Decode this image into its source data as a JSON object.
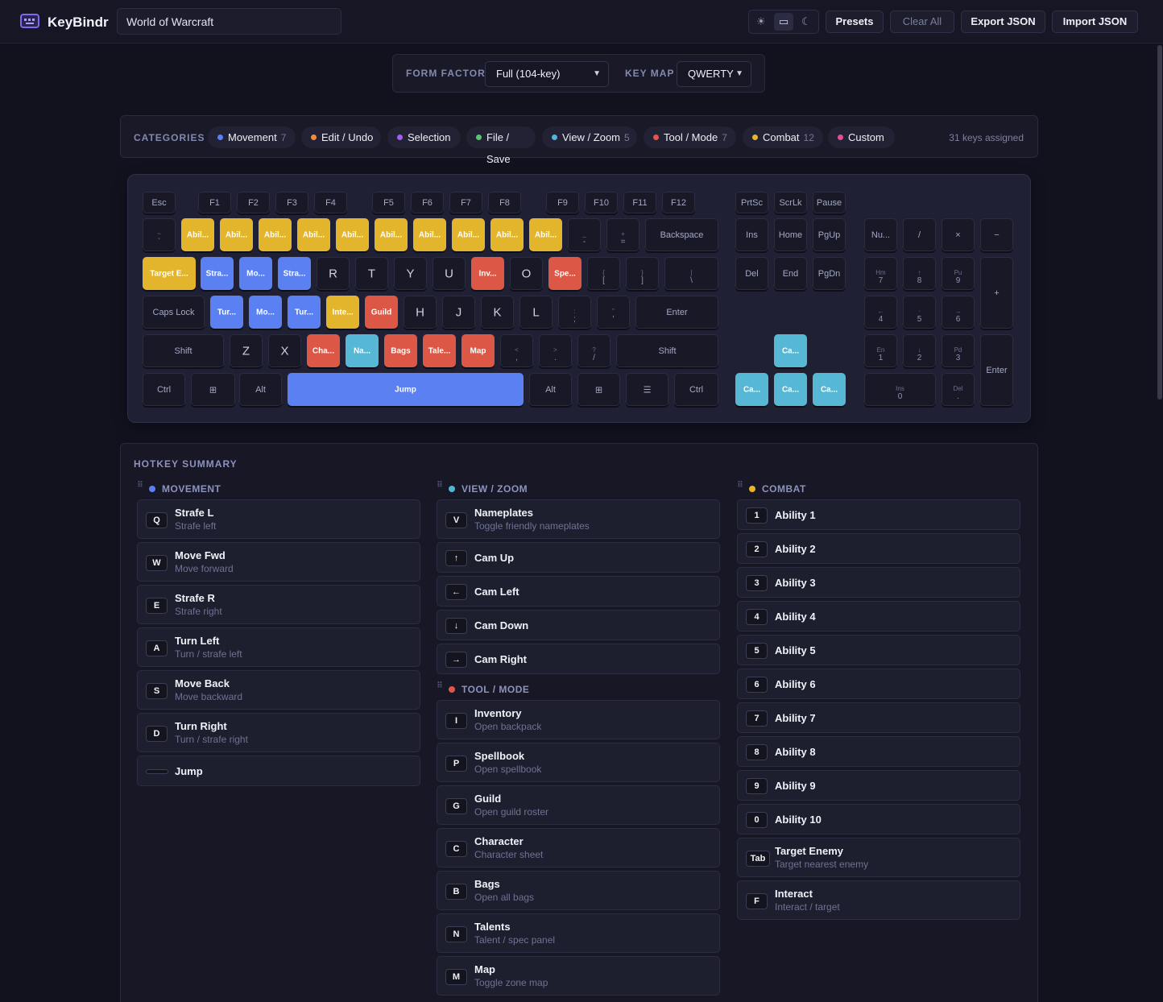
{
  "app": {
    "name": "KeyBindr",
    "preset_name": "World of Warcraft"
  },
  "toolbar": {
    "theme_light": "☀",
    "theme_system": "▭",
    "theme_dark": "☾",
    "presets": "Presets",
    "clear_all": "Clear All",
    "export_json": "Export JSON",
    "import_json": "Import JSON"
  },
  "form": {
    "form_factor_label": "FORM FACTOR",
    "form_factor_value": "Full (104-key)",
    "keymap_label": "KEY MAP",
    "keymap_value": "QWERTY"
  },
  "categories_label": "CATEGORIES",
  "categories": [
    {
      "name": "Movement",
      "count": "7",
      "color": "#5b7ff5"
    },
    {
      "name": "Edit / Undo",
      "count": "",
      "color": "#f08a3c"
    },
    {
      "name": "Selection",
      "count": "",
      "color": "#a55cf0"
    },
    {
      "name": "File / Save",
      "count": "",
      "color": "#55c76a"
    },
    {
      "name": "View / Zoom",
      "count": "5",
      "color": "#4fb6d6"
    },
    {
      "name": "Tool / Mode",
      "count": "7",
      "color": "#e0584a"
    },
    {
      "name": "Combat",
      "count": "12",
      "color": "#e6b52c"
    },
    {
      "name": "Custom",
      "count": "",
      "color": "#e4508f"
    }
  ],
  "assigned_text": "31 keys assigned",
  "keys": [
    {
      "t": "Esc"
    },
    {
      "t": "F1"
    },
    {
      "t": "F2"
    },
    {
      "t": "F3"
    },
    {
      "t": "F4"
    },
    {
      "t": "F5"
    },
    {
      "t": "F6"
    },
    {
      "t": "F7"
    },
    {
      "t": "F8"
    },
    {
      "t": "F9"
    },
    {
      "t": "F10"
    },
    {
      "t": "F11"
    },
    {
      "t": "F12"
    },
    {
      "t": "PrtSc"
    },
    {
      "t": "ScrLk"
    },
    {
      "t": "Pause"
    },
    {
      "t": "~",
      "s": "`"
    },
    {
      "t": "Abil...",
      "c": "combat"
    },
    {
      "t": "Abil...",
      "c": "combat"
    },
    {
      "t": "Abil...",
      "c": "combat"
    },
    {
      "t": "Abil...",
      "c": "combat"
    },
    {
      "t": "Abil...",
      "c": "combat"
    },
    {
      "t": "Abil...",
      "c": "combat"
    },
    {
      "t": "Abil...",
      "c": "combat"
    },
    {
      "t": "Abil...",
      "c": "combat"
    },
    {
      "t": "Abil...",
      "c": "combat"
    },
    {
      "t": "Abil...",
      "c": "combat"
    },
    {
      "t": "_",
      "s": "-"
    },
    {
      "t": "+",
      "s": "="
    },
    {
      "t": "Backspace"
    },
    {
      "t": "Ins"
    },
    {
      "t": "Home"
    },
    {
      "t": "PgUp"
    },
    {
      "t": "Nu..."
    },
    {
      "t": "/"
    },
    {
      "t": "×"
    },
    {
      "t": "−"
    },
    {
      "t": "Target E...",
      "c": "combat"
    },
    {
      "t": "Stra...",
      "c": "movement"
    },
    {
      "t": "Mo...",
      "c": "movement"
    },
    {
      "t": "Stra...",
      "c": "movement"
    },
    {
      "t": "R",
      "b": 1
    },
    {
      "t": "T",
      "b": 1
    },
    {
      "t": "Y",
      "b": 1
    },
    {
      "t": "U",
      "b": 1
    },
    {
      "t": "Inv...",
      "c": "tool"
    },
    {
      "t": "O",
      "b": 1
    },
    {
      "t": "Spe...",
      "c": "tool"
    },
    {
      "t": "{",
      "s": "["
    },
    {
      "t": "}",
      "s": "]"
    },
    {
      "t": "|",
      "s": "\\"
    },
    {
      "t": "Del"
    },
    {
      "t": "End"
    },
    {
      "t": "PgDn"
    },
    {
      "t": "Hm",
      "s": "7"
    },
    {
      "t": "↑",
      "s": "8"
    },
    {
      "t": "Pu",
      "s": "9"
    },
    {
      "t": "+"
    },
    {
      "t": "Caps Lock"
    },
    {
      "t": "Tur...",
      "c": "movement"
    },
    {
      "t": "Mo...",
      "c": "movement"
    },
    {
      "t": "Tur...",
      "c": "movement"
    },
    {
      "t": "Inte...",
      "c": "combat"
    },
    {
      "t": "Guild",
      "c": "tool"
    },
    {
      "t": "H",
      "b": 1
    },
    {
      "t": "J",
      "b": 1
    },
    {
      "t": "K",
      "b": 1
    },
    {
      "t": "L",
      "b": 1
    },
    {
      "t": ":",
      "s": ";"
    },
    {
      "t": "\"",
      "s": "'"
    },
    {
      "t": "Enter"
    },
    {
      "t": "←",
      "s": "4"
    },
    {
      "t": "·",
      "s": "5"
    },
    {
      "t": "→",
      "s": "6"
    },
    {
      "t": "Shift"
    },
    {
      "t": "Z",
      "b": 1
    },
    {
      "t": "X",
      "b": 1
    },
    {
      "t": "Cha...",
      "c": "tool"
    },
    {
      "t": "Na...",
      "c": "view"
    },
    {
      "t": "Bags",
      "c": "tool"
    },
    {
      "t": "Tale...",
      "c": "tool"
    },
    {
      "t": "Map",
      "c": "tool"
    },
    {
      "t": "<",
      "s": ","
    },
    {
      "t": ">",
      "s": "."
    },
    {
      "t": "?",
      "s": "/"
    },
    {
      "t": "Shift"
    },
    {
      "t": "Ca...",
      "c": "view"
    },
    {
      "t": "En",
      "s": "1"
    },
    {
      "t": "↓",
      "s": "2"
    },
    {
      "t": "Pd",
      "s": "3"
    },
    {
      "t": "Enter"
    },
    {
      "t": "Ctrl"
    },
    {
      "t": "⊞"
    },
    {
      "t": "Alt"
    },
    {
      "t": "Jump",
      "c": "movement"
    },
    {
      "t": "Alt"
    },
    {
      "t": "⊞"
    },
    {
      "t": "☰"
    },
    {
      "t": "Ctrl"
    },
    {
      "t": "Ca...",
      "c": "view"
    },
    {
      "t": "Ca...",
      "c": "view"
    },
    {
      "t": "Ca...",
      "c": "view"
    },
    {
      "t": "Ins",
      "s": "0"
    },
    {
      "t": "Del",
      "s": "."
    }
  ],
  "key_colors": {
    "combat": "#e3b52c",
    "movement": "#5b80f2",
    "tool": "#dc5746",
    "view": "#56b8d4"
  },
  "summary": {
    "title": "HOTKEY SUMMARY",
    "groups": [
      {
        "title": "MOVEMENT",
        "color": "#5b7ff5",
        "items": [
          {
            "key": "Q",
            "name": "Strafe L",
            "desc": "Strafe left"
          },
          {
            "key": "W",
            "name": "Move Fwd",
            "desc": "Move forward"
          },
          {
            "key": "E",
            "name": "Strafe R",
            "desc": "Strafe right"
          },
          {
            "key": "A",
            "name": "Turn Left",
            "desc": "Turn / strafe left"
          },
          {
            "key": "S",
            "name": "Move Back",
            "desc": "Move backward"
          },
          {
            "key": "D",
            "name": "Turn Right",
            "desc": "Turn / strafe right"
          },
          {
            "key": "",
            "name": "Jump",
            "desc": ""
          }
        ]
      },
      {
        "title": "VIEW / ZOOM",
        "color": "#4fb6d6",
        "items": [
          {
            "key": "V",
            "name": "Nameplates",
            "desc": "Toggle friendly nameplates"
          },
          {
            "key": "↑",
            "name": "Cam Up",
            "desc": ""
          },
          {
            "key": "←",
            "name": "Cam Left",
            "desc": ""
          },
          {
            "key": "↓",
            "name": "Cam Down",
            "desc": ""
          },
          {
            "key": "→",
            "name": "Cam Right",
            "desc": ""
          }
        ]
      },
      {
        "title": "TOOL / MODE",
        "color": "#e0584a",
        "items": [
          {
            "key": "I",
            "name": "Inventory",
            "desc": "Open backpack"
          },
          {
            "key": "P",
            "name": "Spellbook",
            "desc": "Open spellbook"
          },
          {
            "key": "G",
            "name": "Guild",
            "desc": "Open guild roster"
          },
          {
            "key": "C",
            "name": "Character",
            "desc": "Character sheet"
          },
          {
            "key": "B",
            "name": "Bags",
            "desc": "Open all bags"
          },
          {
            "key": "N",
            "name": "Talents",
            "desc": "Talent / spec panel"
          },
          {
            "key": "M",
            "name": "Map",
            "desc": "Toggle zone map"
          }
        ]
      },
      {
        "title": "COMBAT",
        "color": "#e6b52c",
        "items": [
          {
            "key": "1",
            "name": "Ability 1",
            "desc": ""
          },
          {
            "key": "2",
            "name": "Ability 2",
            "desc": ""
          },
          {
            "key": "3",
            "name": "Ability 3",
            "desc": ""
          },
          {
            "key": "4",
            "name": "Ability 4",
            "desc": ""
          },
          {
            "key": "5",
            "name": "Ability 5",
            "desc": ""
          },
          {
            "key": "6",
            "name": "Ability 6",
            "desc": ""
          },
          {
            "key": "7",
            "name": "Ability 7",
            "desc": ""
          },
          {
            "key": "8",
            "name": "Ability 8",
            "desc": ""
          },
          {
            "key": "9",
            "name": "Ability 9",
            "desc": ""
          },
          {
            "key": "0",
            "name": "Ability 10",
            "desc": ""
          },
          {
            "key": "Tab",
            "name": "Target Enemy",
            "desc": "Target nearest enemy"
          },
          {
            "key": "F",
            "name": "Interact",
            "desc": "Interact / target"
          }
        ]
      }
    ]
  }
}
